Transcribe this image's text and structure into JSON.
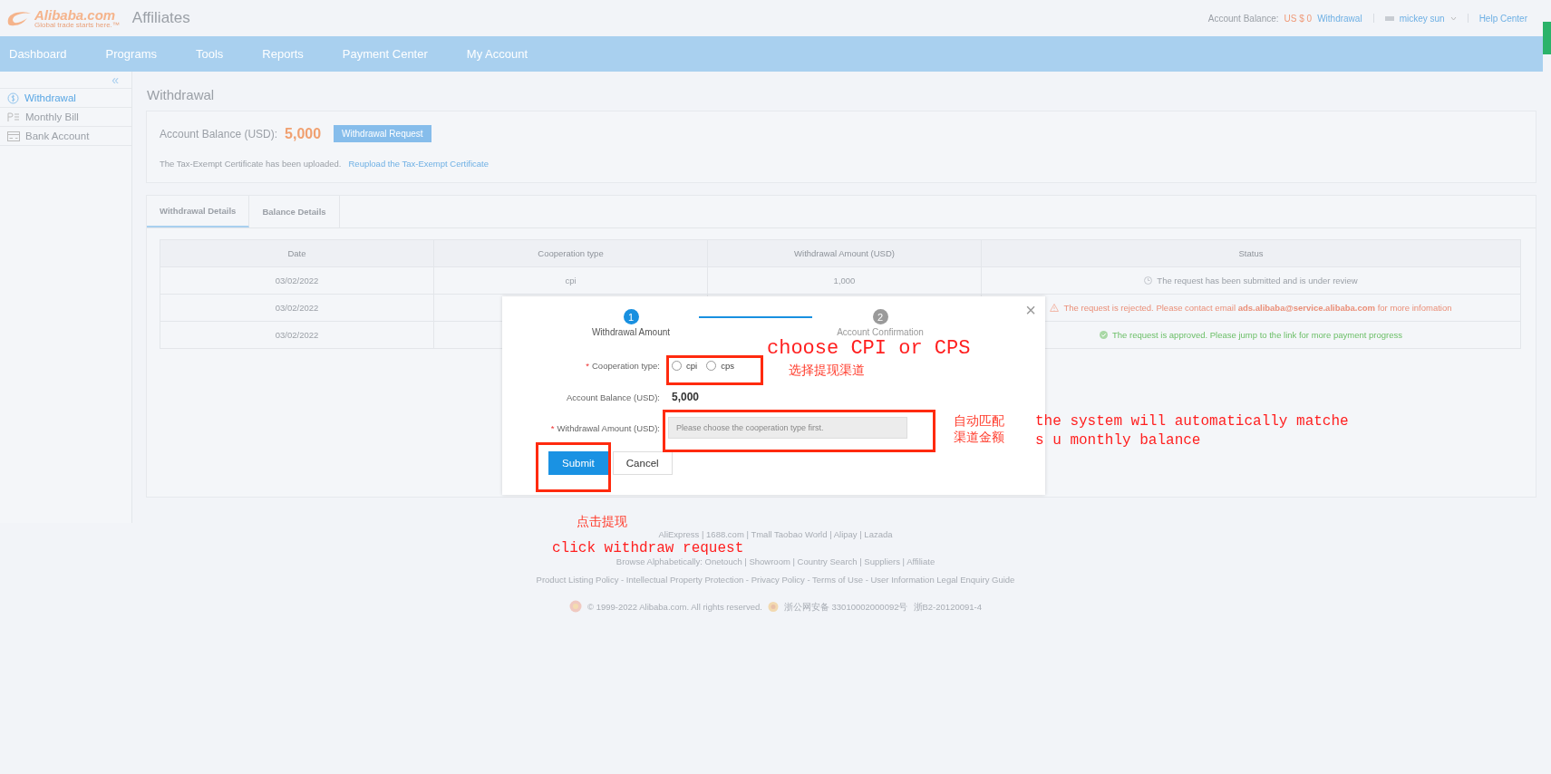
{
  "header": {
    "logo": {
      "name": "Alibaba.com",
      "tagline": "Global trade starts here.™"
    },
    "app_title": "Affiliates",
    "balance_label": "Account Balance:",
    "balance_value": "US $ 0",
    "withdrawal_link": "Withdrawal",
    "user": "mickey sun",
    "help": "Help Center"
  },
  "nav": [
    {
      "label": "Dashboard",
      "selected": false
    },
    {
      "label": "Programs",
      "selected": false
    },
    {
      "label": "Tools",
      "selected": false
    },
    {
      "label": "Reports",
      "selected": false
    },
    {
      "label": "Payment Center",
      "selected": false
    },
    {
      "label": "My Account",
      "selected": false
    }
  ],
  "sidebar": {
    "collapse": "«",
    "items": [
      {
        "label": "Withdrawal",
        "kind": "dollar",
        "selected": true
      },
      {
        "label": "Monthly Bill",
        "kind": "bill",
        "selected": false
      },
      {
        "label": "Bank Account",
        "kind": "card",
        "selected": false
      }
    ]
  },
  "page_title": "Withdrawal",
  "balance_card": {
    "label": "Account Balance (USD):",
    "value": "5,000",
    "button": "Withdrawal Request",
    "notice": "The Tax-Exempt Certificate has been uploaded.",
    "link": "Reupload the Tax-Exempt Certificate"
  },
  "tabs": [
    {
      "label": "Withdrawal Details",
      "selected": true
    },
    {
      "label": "Balance Details",
      "selected": false
    }
  ],
  "table": {
    "columns": [
      "Date",
      "Cooperation type",
      "Withdrawal Amount (USD)",
      "Status"
    ],
    "rows": [
      {
        "date": "03/02/2022",
        "cooperation_type": "cpi",
        "amount": "1,000",
        "status": {
          "kind": "pending",
          "text": "The request has been submitted and is under review"
        }
      },
      {
        "date": "03/02/2022",
        "status": {
          "kind": "rejected",
          "text": "The request is rejected. Please contact email **ads.alibaba@service.alibaba.com** for more infomation"
        }
      },
      {
        "date": "03/02/2022",
        "status": {
          "kind": "approved",
          "text": "The request is approved. Please jump to the link for more payment progress"
        }
      }
    ]
  },
  "modal": {
    "close": "×",
    "steps": [
      {
        "number": "1",
        "label": "Withdrawal Amount",
        "selected": true
      },
      {
        "number": "2",
        "label": "Account Confirmation",
        "selected": false
      }
    ],
    "cooperation": {
      "required_mark": "*",
      "label": "Cooperation type:",
      "options": [
        {
          "label": "cpi",
          "selected": false
        },
        {
          "label": "cps",
          "selected": false
        }
      ]
    },
    "balance": {
      "label": "Account Balance (USD):",
      "value": "5,000"
    },
    "amount": {
      "required_mark": "*",
      "label": "Withdrawal Amount (USD):",
      "placeholder": "Please choose the cooperation type first."
    },
    "buttons": [
      {
        "label": "Submit",
        "kind": "primary"
      },
      {
        "label": "Cancel",
        "kind": "default"
      }
    ]
  },
  "footer": {
    "lines": [
      "AliExpress | 1688.com | Tmall Taobao World | Alipay | Lazada",
      "Browse Alphabetically: Onetouch | Showroom | Country Search | Suppliers | Affiliate",
      "Product Listing Policy - Intellectual Property Protection - Privacy Policy - Terms of Use - User Information Legal Enquiry Guide"
    ],
    "copyright": "© 1999-2022 Alibaba.com. All rights reserved.",
    "police": "浙公网安备 33010002000092号",
    "license": "浙B2-20120091-4"
  },
  "annotations": [
    {
      "kind": "box"
    },
    {
      "kind": "box"
    },
    {
      "kind": "box"
    },
    {
      "kind": "note",
      "text": "choose CPI or CPS"
    },
    {
      "kind": "note",
      "text": "选择提现渠道"
    },
    {
      "kind": "note",
      "text": "自动匹配渠道金额"
    },
    {
      "kind": "note",
      "text": "the system will automatically matche\ns u monthly balance"
    },
    {
      "kind": "note",
      "text": "点击提现"
    },
    {
      "kind": "note",
      "text": "click withdraw request"
    }
  ]
}
